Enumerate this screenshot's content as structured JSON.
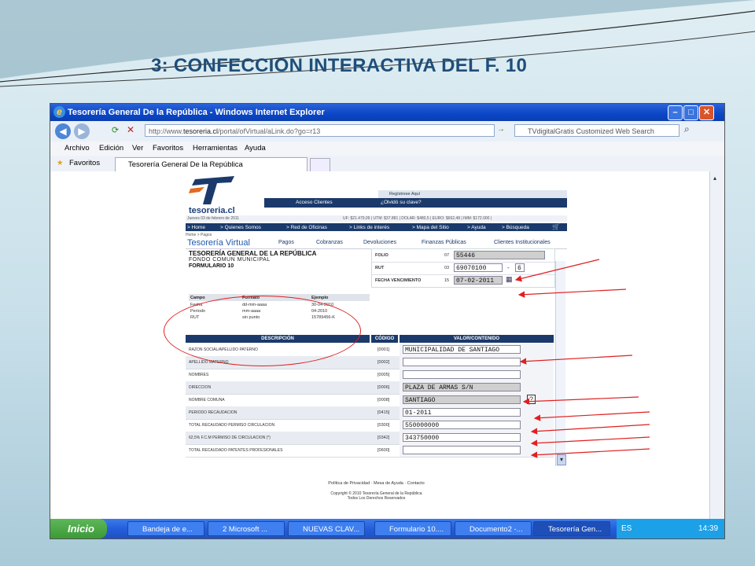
{
  "slide": {
    "title": "3: CONFECCION INTERACTIVA DEL F. 10"
  },
  "window": {
    "title": "Tesorería General De la República - Windows Internet Explorer",
    "url_prefix": "http://www.",
    "url_domain": "tesoreria.cl",
    "url_path": "/portal/ofVirtual/aLink.do?go=r13",
    "search_placeholder": "TVdigitalGratis Customized Web Search",
    "menu": [
      "Archivo",
      "Edición",
      "Ver",
      "Favoritos",
      "Herramientas",
      "Ayuda"
    ],
    "favorites_label": "Favoritos",
    "tab_label": "Tesorería General De la República"
  },
  "site": {
    "logo_text": "tesoreria.cl",
    "register_link": "Regístrese Aquí",
    "access_clients": "Acceso Clientes",
    "forgot_key": "¿Olvidó su clave?",
    "date_line": "Jueves 03 de febrero de 2011",
    "indicators": "UF: $21.479,09 | UTM: $37.881 | DOLAR: $480,5 | EURO: $662,48 | IMM: $172.000 |",
    "nav": [
      "> Home",
      "> Quienes Somos",
      "> Red de Oficinas",
      "> Links de interés",
      "> Mapa del Sitio",
      "> Ayuda",
      "> Búsqueda"
    ],
    "breadcrumb": "Home > Pagos",
    "virtual_title": "Tesorería Virtual",
    "virtual_links": [
      "Pagos",
      "Cobranzas",
      "Devoluciones",
      "Finanzas Públicas",
      "Clientes Institucionales"
    ]
  },
  "form": {
    "header1": "TESORERÍA GENERAL DE LA REPÚBLICA",
    "header2": "FONDO COMUN MUNICIPAL",
    "header3": "FORMULARIO 10",
    "folio_label": "FOLIO",
    "folio_code": "07",
    "folio_value": "55446",
    "rut_label": "RUT",
    "rut_code": "03",
    "rut_value": "69070100",
    "rut_dash": "-",
    "rut_dv": "6",
    "fecha_label": "FECHA VENCIMIENTO",
    "fecha_code": "15",
    "fecha_value": "07-02-2011",
    "format_headers": [
      "Campo",
      "Formato",
      "Ejemplo"
    ],
    "format_rows": [
      [
        "Fecha",
        "dd-mm-aaaa",
        "30-04-2010"
      ],
      [
        "Periodo",
        "mm-aaaa",
        "04-2010"
      ],
      [
        "RUT",
        "sin punto",
        "15789456-K"
      ]
    ],
    "table_headers": [
      "DESCRIPCIÓN",
      "CÓDIGO",
      "VALOR/CONTENIDO"
    ],
    "rows": [
      {
        "desc": "RAZON SOCIAL/APELLIDO PATERNO",
        "code": "[0001]",
        "value": "MUNICIPALIDAD DE SANTIAGO"
      },
      {
        "desc": "APELLIDO MATERNO",
        "code": "[0002]",
        "value": ""
      },
      {
        "desc": "NOMBRES",
        "code": "[0005]",
        "value": ""
      },
      {
        "desc": "DIRECCION",
        "code": "[0006]",
        "value": "PLAZA DE ARMAS S/N"
      },
      {
        "desc": "NOMBRE COMUNA",
        "code": "[0008]",
        "value": "SANTIAGO"
      },
      {
        "desc": "PERIODO RECAUDACION",
        "code": "[0415]",
        "value": "01-2011"
      },
      {
        "desc": "TOTAL RECAUDADO PERMISO CIRCULACION",
        "code": "[0300]",
        "value": "550000000"
      },
      {
        "desc": "62,5% F.C.M PERMISO DE CIRCULACION (*)",
        "code": "[0342]",
        "value": "343750000"
      },
      {
        "desc": "TOTAL RECAUDADO PATENTES PROFESIONALES",
        "code": "[0600]",
        "value": ""
      }
    ],
    "footer_links": "Política de Privacidad · Mesa de Ayuda · Contacto",
    "copyright": "Copyright © 2010 Tesorería General de la República",
    "rights": "Todos Los Derechos Reservados"
  },
  "taskbar": {
    "start": "Inicio",
    "items": [
      "Bandeja de e...",
      "2 Microsoft ...",
      "NUEVAS CLAV...",
      "Formulario 10....",
      "Documento2 -...",
      "Tesorería Gen..."
    ],
    "lang": "ES",
    "time": "14:39"
  },
  "colors": {
    "annotation": "#e02020",
    "title": "#1f4e79",
    "site_navy": "#1b3a6b"
  }
}
